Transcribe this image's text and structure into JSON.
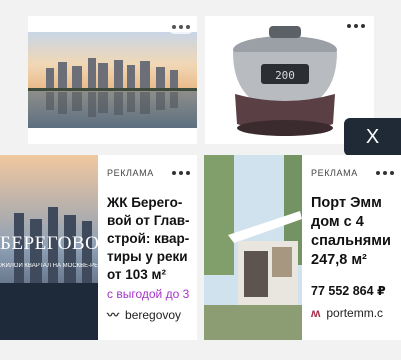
{
  "top_cards": {
    "left": {
      "image": "city-waterfront-photo"
    },
    "right": {
      "image": "multicooker-photo"
    }
  },
  "close_button": {
    "label": "X"
  },
  "ads": [
    {
      "label": "РЕКЛАМА",
      "title": "ЖК Берего-вой от Глав-строй: квар-тиры у реки от 103 м²",
      "promo": "с выгодой до 3",
      "domain": "beregovoy",
      "image_brand": "БЕРЕГОВОЙ",
      "image_sub": "ЖИЛОЙ КВАРТАЛ НА МОСКВЕ-РЕКЕ"
    },
    {
      "label": "РЕКЛАМА",
      "title": "Порт Эмм дом с 4 спальнями 247,8 м²",
      "price": "77 552 864 ₽",
      "domain": "portemm.c"
    }
  ]
}
